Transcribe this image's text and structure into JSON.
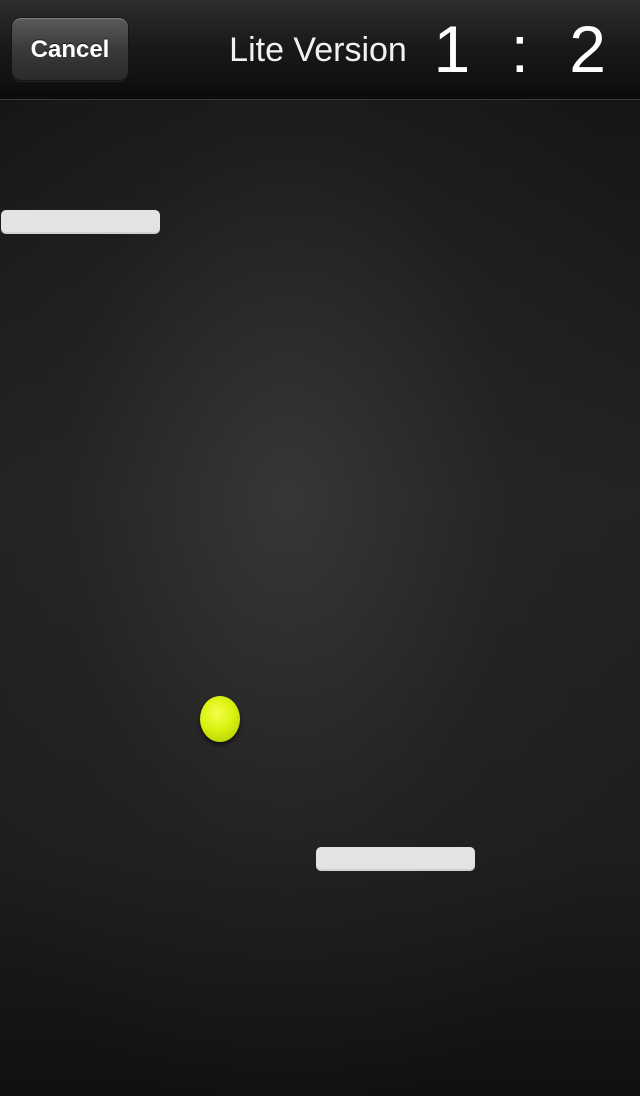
{
  "navbar": {
    "cancel_label": "Cancel",
    "title": "Lite Version",
    "score": {
      "left": "1",
      "separator": ":",
      "right": "2"
    }
  },
  "court": {
    "paddles": [
      "player-paddle-top",
      "opponent-paddle-bottom"
    ],
    "ball_color": "#d9f20f",
    "paddle_color": "#e3e3e3"
  }
}
